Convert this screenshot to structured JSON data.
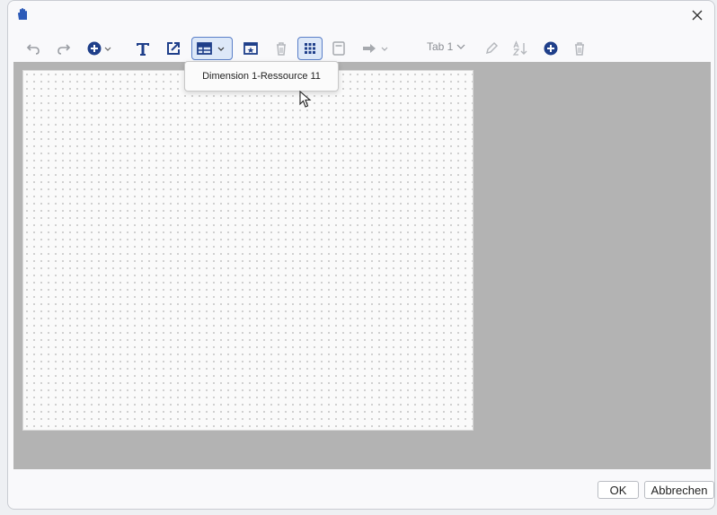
{
  "toolbar": {
    "icons": [
      "undo-icon",
      "redo-icon",
      "add-circle-icon",
      "text-icon",
      "external-link-icon",
      "table-icon",
      "frame-star-icon",
      "trash-icon",
      "grid-icon",
      "panel-icon",
      "arrow-right-icon",
      "pencil-icon",
      "sort-az-icon",
      "add-icon",
      "trash-icon"
    ],
    "tab_select": "Tab 1"
  },
  "popup": {
    "item": "Dimension 1-Ressource 11"
  },
  "footer": {
    "ok_label": "OK",
    "cancel_label": "Abbrechen"
  },
  "colors": {
    "accent": "#1f3f8a",
    "active_border": "#5a7fc8",
    "workspace_bg": "#b3b3b3"
  }
}
